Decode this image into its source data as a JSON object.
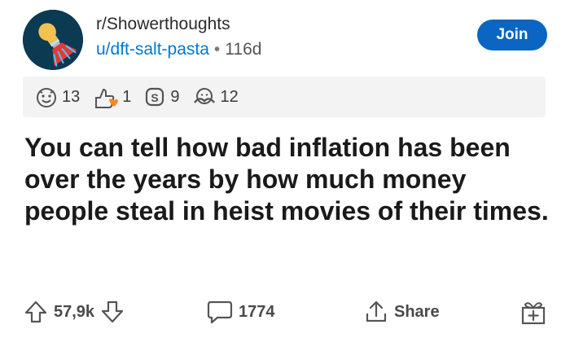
{
  "post": {
    "subreddit": "r/Showerthoughts",
    "username": "u/dft-salt-pasta",
    "separator": "•",
    "age": "116d",
    "join_label": "Join",
    "title": "You can tell how bad inflation has been over the years by how much money people steal in heist movies of their times."
  },
  "awards": [
    {
      "icon": "helpful-award-icon",
      "count": "13"
    },
    {
      "icon": "wholesome-award-icon",
      "count": "1"
    },
    {
      "icon": "silver-coin-award-icon",
      "count": "9"
    },
    {
      "icon": "hugz-award-icon",
      "count": "12"
    }
  ],
  "actions": {
    "votes": "57,9k",
    "comments": "1774",
    "share_label": "Share"
  },
  "colors": {
    "accent": "#0079d3",
    "join_bg": "#0a66c2",
    "award_bar_bg": "#f3f3f3"
  }
}
